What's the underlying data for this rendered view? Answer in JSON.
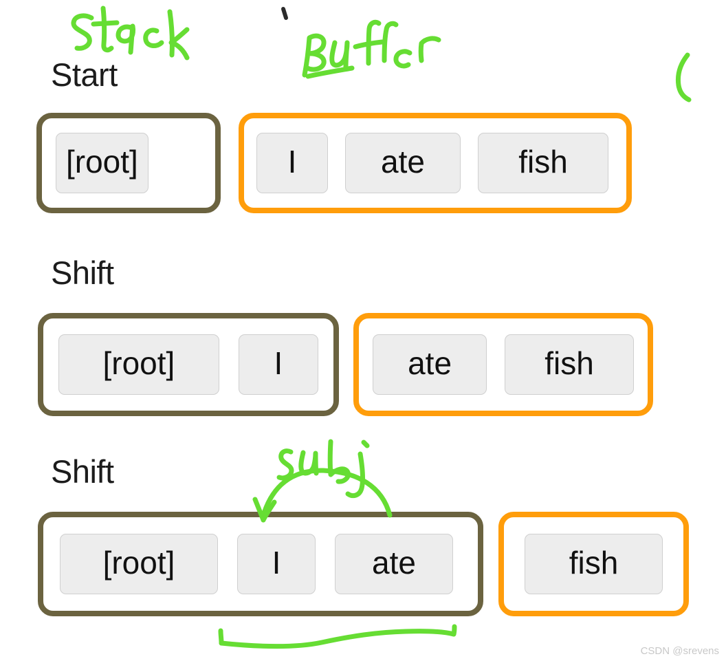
{
  "colors": {
    "stack_border": "#6b6340",
    "buffer_border": "#ff9d0b",
    "token_fill": "#ededed",
    "token_border": "#cfcfcf",
    "ink_green": "#66dd33",
    "text": "#1c1c1c",
    "background": "#ffffff",
    "watermark": "#c8c8c8"
  },
  "annotations": {
    "stack_label": "Stack",
    "buffer_label": "Buffer",
    "subj_label": "subj"
  },
  "rows": [
    {
      "step": "Start",
      "stack": [
        "[root]"
      ],
      "buffer": [
        "I",
        "ate",
        "fish"
      ]
    },
    {
      "step": "Shift",
      "stack": [
        "[root]",
        "I"
      ],
      "buffer": [
        "ate",
        "fish"
      ]
    },
    {
      "step": "Shift",
      "stack": [
        "[root]",
        "I",
        "ate"
      ],
      "buffer": [
        "fish"
      ]
    }
  ],
  "watermark": "CSDN @srevens"
}
